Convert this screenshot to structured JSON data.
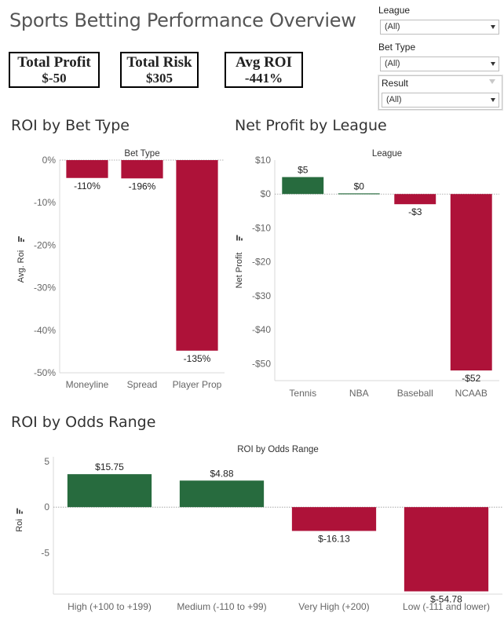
{
  "dashboard": {
    "title": "Sports Betting Performance Overview"
  },
  "kpis": {
    "profit": {
      "label": "Total Profit",
      "value": "$-50"
    },
    "risk": {
      "label": "Total Risk",
      "value": "$305"
    },
    "roi": {
      "label": "Avg ROI",
      "value": "-441%"
    }
  },
  "filters": {
    "league": {
      "label": "League",
      "value": "(All)"
    },
    "bet_type": {
      "label": "Bet Type",
      "value": "(All)"
    },
    "result": {
      "label": "Result",
      "value": "(All)"
    }
  },
  "sections": {
    "roi_bet_type": "ROI by Bet Type",
    "net_profit_league": "Net Profit by League",
    "roi_odds_range": "ROI by Odds Range"
  },
  "colors": {
    "positive": "#276b3e",
    "negative": "#ae1239",
    "axis_text": "#666666",
    "zero_line": "#999999"
  },
  "chart_data": [
    {
      "type": "bar",
      "header": "Bet Type",
      "ylabel": "Avg. Roi",
      "categories": [
        "Moneyline",
        "Spread",
        "Player Prop"
      ],
      "values": [
        -4.2,
        -4.3,
        -44.8
      ],
      "value_labels": [
        "-110%",
        "-196%",
        "-135%"
      ],
      "ylim": [
        -50,
        0
      ],
      "yticks": [
        0,
        -10,
        -20,
        -30,
        -40,
        -50
      ],
      "ytick_labels": [
        "0%",
        "-10%",
        "-20%",
        "-30%",
        "-40%",
        "-50%"
      ],
      "grid": false
    },
    {
      "type": "bar",
      "header": "League",
      "ylabel": "Net Profit",
      "categories": [
        "Tennis",
        "NBA",
        "Baseball",
        "NCAAB"
      ],
      "values": [
        5,
        0.2,
        -3,
        -52
      ],
      "value_labels": [
        "$5",
        "$0",
        "-$3",
        "-$52"
      ],
      "ylim": [
        -55,
        10
      ],
      "yticks": [
        10,
        0,
        -10,
        -20,
        -30,
        -40,
        -50
      ],
      "ytick_labels": [
        "$10",
        "$0",
        "-$10",
        "-$20",
        "-$30",
        "-$40",
        "-$50"
      ],
      "grid": false
    },
    {
      "type": "bar",
      "header": "ROI by Odds Range",
      "ylabel": "Roi",
      "categories": [
        "High (+100 to +199)",
        "Medium (-110 to +99)",
        "Very High (+200)",
        "Low (-111 and lower)"
      ],
      "values": [
        3.6,
        2.9,
        -2.6,
        -9.2
      ],
      "value_labels": [
        "$15.75",
        "$4.88",
        "$-16.13",
        "$-54.78"
      ],
      "ylim": [
        -9.5,
        5.5
      ],
      "yticks": [
        5,
        0,
        -5
      ],
      "ytick_labels": [
        "5",
        "0",
        "-5"
      ],
      "grid": false
    }
  ]
}
